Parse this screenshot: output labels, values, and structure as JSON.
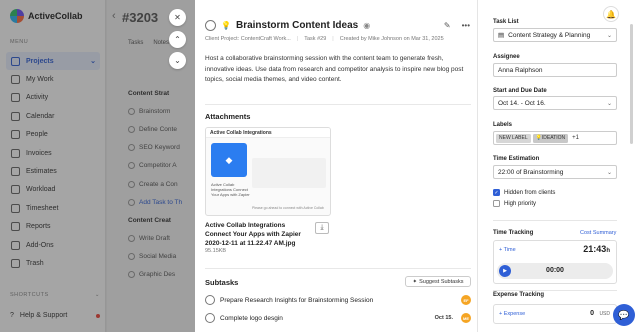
{
  "app": {
    "name": "ActiveCollab"
  },
  "sidebar": {
    "menu_header": "MENU",
    "items": [
      {
        "label": "Projects",
        "icon": "folder-icon",
        "active": true
      },
      {
        "label": "My Work",
        "icon": "user-icon"
      },
      {
        "label": "Activity",
        "icon": "activity-icon"
      },
      {
        "label": "Calendar",
        "icon": "calendar-icon"
      },
      {
        "label": "People",
        "icon": "people-icon"
      },
      {
        "label": "Invoices",
        "icon": "invoice-icon"
      },
      {
        "label": "Estimates",
        "icon": "estimate-icon"
      },
      {
        "label": "Workload",
        "icon": "workload-icon"
      },
      {
        "label": "Timesheet",
        "icon": "timesheet-icon"
      },
      {
        "label": "Reports",
        "icon": "reports-icon"
      },
      {
        "label": "Add-Ons",
        "icon": "addons-icon"
      },
      {
        "label": "Trash",
        "icon": "trash-icon"
      }
    ],
    "shortcuts_label": "SHORTCUTS",
    "help_label": "Help & Support"
  },
  "background": {
    "title": "#3203",
    "tabs": [
      "Tasks",
      "Notes"
    ],
    "rows": [
      "Content Strat",
      "Brainstorm",
      "Define Conte",
      "SEO Keyword",
      "Competitor A",
      "Create a Con",
      "Add Task to Th",
      "Content Creat",
      "Write Draft",
      "Social Media",
      "Graphic Des"
    ]
  },
  "modal_controls": {
    "close": "✕",
    "up": "⌃",
    "down": "⌄"
  },
  "task": {
    "title": "Brainstorm Content Ideas",
    "project": "Client Project: ContentCraft Work...",
    "number": "Task #29",
    "created": "Created by Mike Johnson on Mar 31, 2025",
    "description": "Host a collaborative brainstorming session with the content team to generate fresh, innovative ideas. Use data from research and competitor analysis to inspire new blog post topics, social media themes, and video content."
  },
  "attachments": {
    "heading": "Attachments",
    "file_name": "Active Collab Integrations Connect Your Apps with Zapier 2020-12-11 at 11.22.47 AM.jpg",
    "file_size": "95.15KB",
    "thumb_title": "Active Collab Integrations",
    "thumb_text": "Active Collab Integrations Connect Your Apps with Zapier",
    "thumb_footer": "Please go ahead to connect with Active Collab"
  },
  "subtasks": {
    "heading": "Subtasks",
    "suggest_label": "Suggest Subtasks",
    "items": [
      {
        "label": "Prepare Research Insights for Brainstorming Session",
        "date": "",
        "avatar": "EF"
      },
      {
        "label": "Complete logo desgin",
        "date": "Oct 15.",
        "avatar": "ME"
      }
    ]
  },
  "properties": {
    "task_list_label": "Task List",
    "task_list_value": "Content Strategy & Planning",
    "assignee_label": "Assignee",
    "assignee_value": "Anna Ralphson",
    "dates_label": "Start and Due Date",
    "dates_value": "Oct 14. - Oct 16.",
    "labels_label": "Labels",
    "labels": [
      "NEW LABEL",
      "IDEATION"
    ],
    "labels_more": "+1",
    "estimation_label": "Time Estimation",
    "estimation_value": "22:00 of Brainstorming",
    "hidden_label": "Hidden from clients",
    "hidden_checked": true,
    "priority_label": "High priority",
    "priority_checked": false,
    "time_tracking_label": "Time Tracking",
    "cost_summary_label": "Cost Summary",
    "add_time_label": "+ Time",
    "time_total": "21:43",
    "time_unit": "h",
    "timer_value": "00:00",
    "expense_label": "Expense Tracking",
    "add_expense_label": "+ Expense",
    "expense_value": "0",
    "expense_currency": "USD"
  },
  "colors": {
    "accent": "#2f5fd6",
    "bulb": "#e3a11a",
    "avatar": "#f5a524"
  }
}
